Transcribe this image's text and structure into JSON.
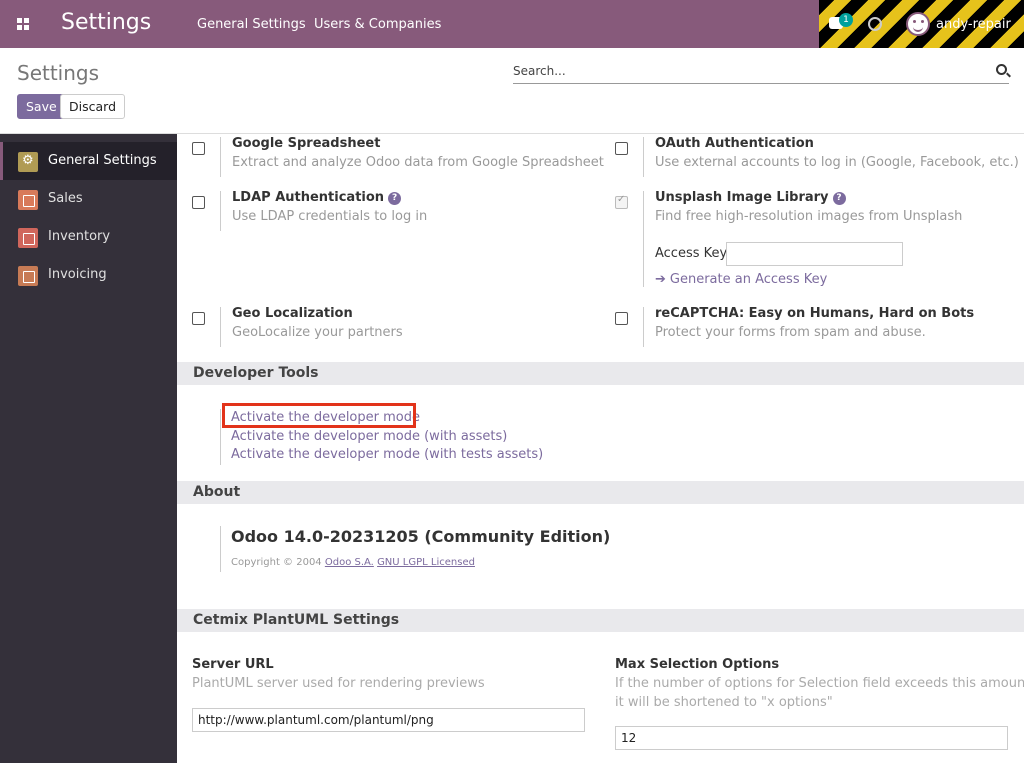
{
  "navbar": {
    "brand": "Settings",
    "menus": [
      "General Settings",
      "Users & Companies"
    ],
    "chat_badge": "1",
    "user_name": "andy-repair"
  },
  "control_panel": {
    "title": "Settings",
    "search_placeholder": "Search...",
    "save_label": "Save",
    "discard_label": "Discard"
  },
  "sidebar": {
    "items": [
      {
        "label": "General Settings",
        "icon": "gear-icon"
      },
      {
        "label": "Sales",
        "icon": "chart-icon"
      },
      {
        "label": "Inventory",
        "icon": "box-icon"
      },
      {
        "label": "Invoicing",
        "icon": "invoice-icon"
      }
    ]
  },
  "integrations": {
    "google_spreadsheet": {
      "title": "Google Spreadsheet",
      "desc": "Extract and analyze Odoo data from Google Spreadsheet"
    },
    "oauth": {
      "title": "OAuth Authentication",
      "desc": "Use external accounts to log in (Google, Facebook, etc.)"
    },
    "ldap": {
      "title": "LDAP Authentication",
      "desc": "Use LDAP credentials to log in"
    },
    "unsplash": {
      "title": "Unsplash Image Library",
      "desc": "Find free high-resolution images from Unsplash",
      "access_key_label": "Access Key",
      "access_key_value": "",
      "generate_link": "Generate an Access Key"
    },
    "geo": {
      "title": "Geo Localization",
      "desc": "GeoLocalize your partners"
    },
    "recaptcha": {
      "title": "reCAPTCHA: Easy on Humans, Hard on Bots",
      "desc": "Protect your forms from spam and abuse."
    }
  },
  "developer_tools": {
    "header": "Developer Tools",
    "links": [
      "Activate the developer mode",
      "Activate the developer mode (with assets)",
      "Activate the developer mode (with tests assets)"
    ]
  },
  "about": {
    "header": "About",
    "version": "Odoo 14.0-20231205 (Community Edition)",
    "copyright_prefix": "Copyright © 2004",
    "company_link": "Odoo S.A.",
    "license_link": "GNU LGPL Licensed"
  },
  "plantuml": {
    "header": "Cetmix PlantUML Settings",
    "server_url": {
      "title": "Server URL",
      "desc": "PlantUML server used for rendering previews",
      "value": "http://www.plantuml.com/plantuml/png"
    },
    "max_options": {
      "title": "Max Selection Options",
      "desc_line1": "If the number of options for Selection field exceeds this amount",
      "desc_line2": "it will be shortened to \"x options\"",
      "value": "12"
    }
  }
}
